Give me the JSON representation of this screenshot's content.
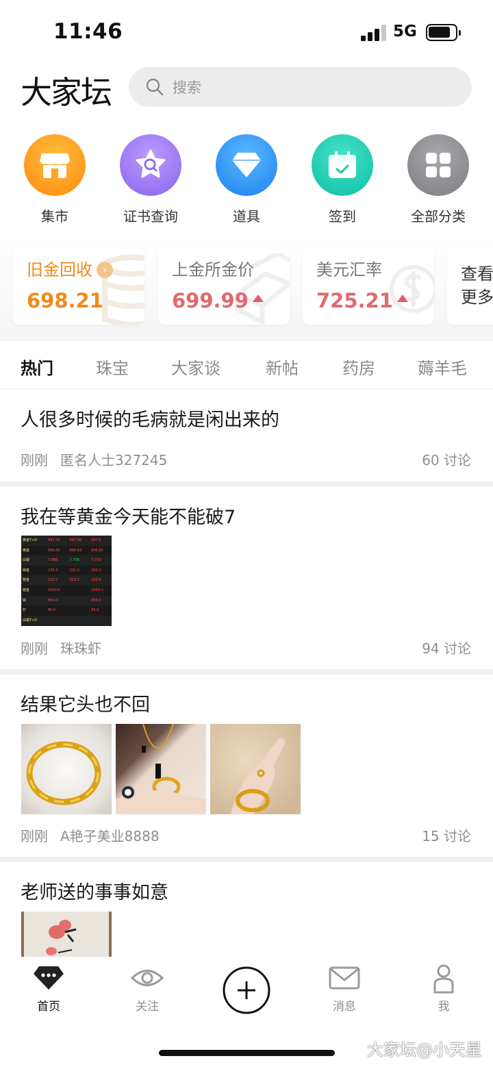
{
  "status": {
    "time": "11:46",
    "network": "5G"
  },
  "header": {
    "logo": "大家坛",
    "search_placeholder": "搜索"
  },
  "shortcuts": [
    {
      "label": "集市",
      "icon": "store-icon",
      "color": "#ff9a18"
    },
    {
      "label": "证书查询",
      "icon": "certificate-icon",
      "color": "#9d7df2"
    },
    {
      "label": "道具",
      "icon": "diamond-icon",
      "color": "#2f95f5"
    },
    {
      "label": "签到",
      "icon": "calendar-icon",
      "color": "#17ccb3"
    },
    {
      "label": "全部分类",
      "icon": "grid-icon",
      "color": "#8e8e92"
    }
  ],
  "price_cards": [
    {
      "title": "旧金回收",
      "value": "698.21",
      "value_color": "#f08a1a"
    },
    {
      "title": "上金所金价",
      "value": "699.99",
      "value_color": "#e06a6e"
    },
    {
      "title": "美元汇率",
      "value": "725.21",
      "value_color": "#e06a6e"
    },
    {
      "title": "查看",
      "title2": "更多"
    }
  ],
  "tabs": [
    "热门",
    "珠宝",
    "大家谈",
    "新帖",
    "药房",
    "薅羊毛"
  ],
  "posts": [
    {
      "title": "人很多时候的毛病就是闲出来的",
      "time": "刚刚",
      "author": "匿名人士327245",
      "count": "60",
      "count_label": "讨论"
    },
    {
      "title": "我在等黄金今天能不能破7",
      "time": "刚刚",
      "author": "珠珠虾",
      "count": "94",
      "count_label": "讨论"
    },
    {
      "title": "结果它头也不回",
      "time": "刚刚",
      "author": "A艳子美业8888",
      "count": "15",
      "count_label": "讨论"
    },
    {
      "title": "老师送的事事如意"
    }
  ],
  "quote_table": {
    "rows": [
      [
        "黄金T+D",
        "697.43",
        "697.46",
        "697.6"
      ],
      [
        "黄金",
        "696.83",
        "696.83",
        "696.85"
      ],
      [
        "白银",
        "7.686",
        "7.736",
        "7.733"
      ],
      [
        "铂金",
        "230.3",
        "231.6",
        "232.1"
      ],
      [
        "钯金",
        "222.2",
        "223.1",
        "222.6"
      ],
      [
        "铑金",
        "1050.0",
        "",
        "1050.0"
      ],
      [
        "铱",
        "850.0",
        "",
        "850.0"
      ],
      [
        "钌",
        "85.0",
        "",
        "85.0"
      ],
      [
        "白银T+D",
        "",
        "",
        ""
      ]
    ]
  },
  "bottom_nav": [
    {
      "label": "首页",
      "icon": "home-diamond-icon"
    },
    {
      "label": "关注",
      "icon": "eye-icon"
    },
    {
      "label": "",
      "icon": "plus-icon"
    },
    {
      "label": "消息",
      "icon": "mail-icon"
    },
    {
      "label": "我",
      "icon": "person-icon"
    }
  ],
  "watermark": "大家坛@小天星",
  "colors": {
    "accent_orange": "#f08a1a",
    "rise_red": "#e06a6e"
  }
}
